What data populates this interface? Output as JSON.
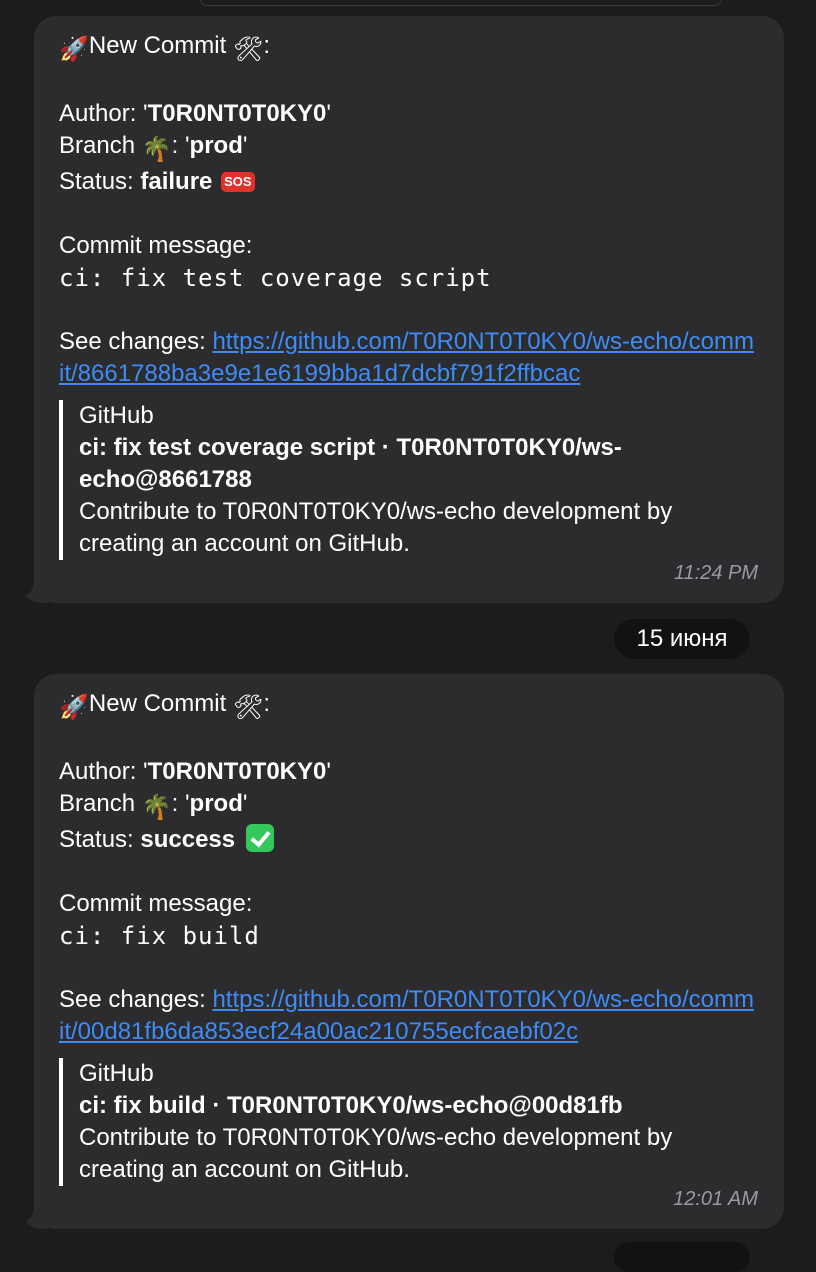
{
  "messages": [
    {
      "header": "New Commit",
      "author_label": "Author: '",
      "author": "T0R0NT0T0KY0",
      "author_suffix": "'",
      "branch_label": "Branch",
      "branch_colon": ": '",
      "branch": "prod",
      "branch_suffix": "'",
      "status_label": "Status: ",
      "status": "failure",
      "status_badge": "SOS",
      "commit_label": "Commit message:",
      "commit_message": "ci: fix test coverage script",
      "changes_label": "See changes: ",
      "changes_link": "https://github.com/T0R0NT0T0KY0/ws-echo/commit/8661788ba3e9e1e6199bba1d7dcbf791f2ffbcac",
      "preview": {
        "site": "GitHub",
        "title": "ci: fix test coverage script · T0R0NT0T0KY0/ws-echo@8661788",
        "description": "Contribute to T0R0NT0T0KY0/ws-echo development by creating an account on GitHub."
      },
      "time": "11:24 PM"
    },
    {
      "header": "New Commit",
      "author_label": "Author: '",
      "author": "T0R0NT0T0KY0",
      "author_suffix": "'",
      "branch_label": "Branch",
      "branch_colon": ": '",
      "branch": "prod",
      "branch_suffix": "'",
      "status_label": "Status: ",
      "status": "success",
      "commit_label": "Commit message:",
      "commit_message": "ci: fix build",
      "changes_label": "See changes: ",
      "changes_link": "https://github.com/T0R0NT0T0KY0/ws-echo/commit/00d81fb6da853ecf24a00ac210755ecfcaebf02c",
      "preview": {
        "site": "GitHub",
        "title": "ci: fix build · T0R0NT0T0KY0/ws-echo@00d81fb",
        "description": "Contribute to T0R0NT0T0KY0/ws-echo development by creating an account on GitHub."
      },
      "time": "12:01 AM"
    }
  ],
  "date_separator": "15 июня",
  "icons": {
    "rocket": "rocket-icon",
    "tools": "hammer-wrench-icon",
    "palm": "palm-tree-icon",
    "sos": "sos-icon",
    "check": "check-mark-icon"
  },
  "colors": {
    "background": "#1c1c1e",
    "bubble": "#2c2c2e",
    "link": "#3f8bf6",
    "timestamp": "#9a9aa0",
    "sos_red": "#e0312b",
    "check_green": "#34c759"
  }
}
